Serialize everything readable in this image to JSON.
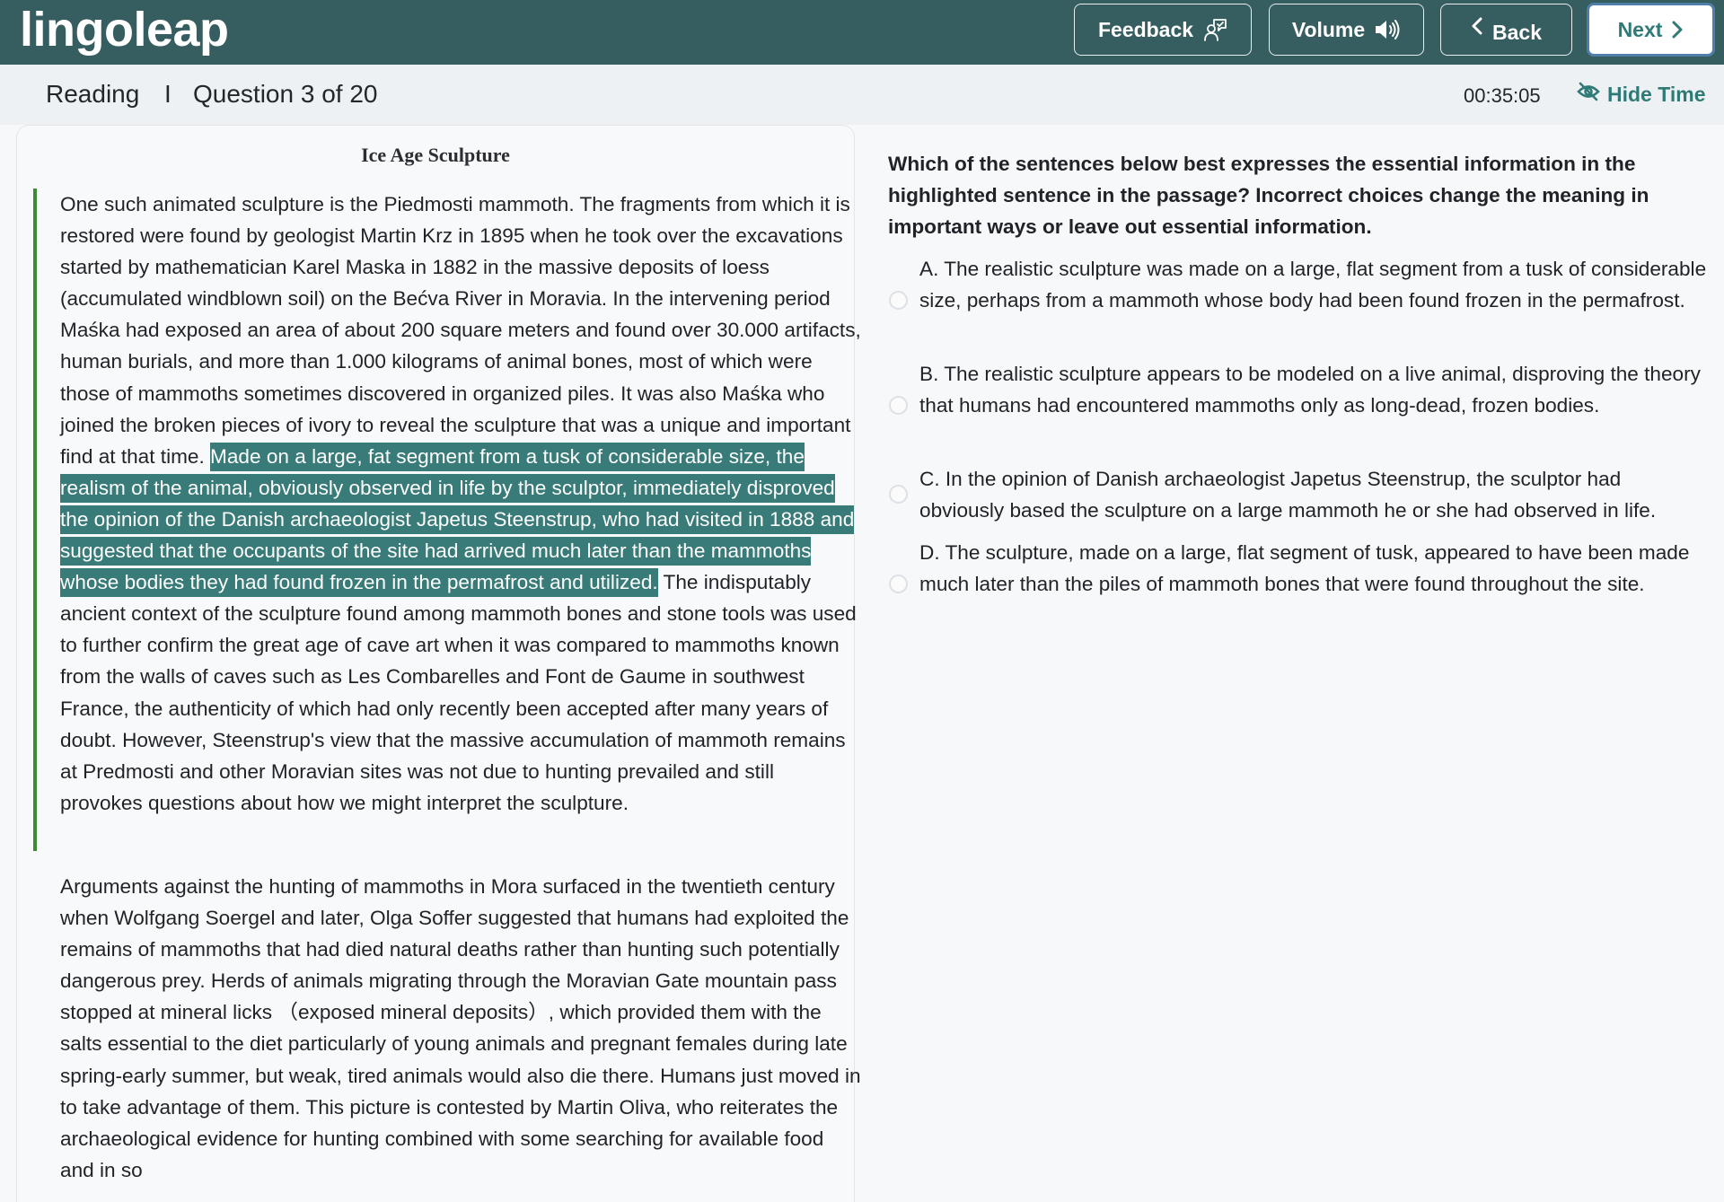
{
  "header": {
    "logo": "lingoleap",
    "buttons": {
      "feedback": "Feedback",
      "volume": "Volume",
      "back": "Back",
      "next": "Next"
    },
    "icons": {
      "feedback": "feedback-person-chat-icon",
      "volume": "speaker-volume-icon",
      "back": "chevron-left-icon",
      "next": "chevron-right-icon"
    }
  },
  "subheader": {
    "section": "Reading",
    "separator": "I",
    "question_progress": "Question 3 of 20",
    "timer": "00:35:05",
    "hide_time_label": "Hide Time",
    "hide_time_icon": "eye-slash-icon"
  },
  "passage": {
    "title": "Ice Age Sculpture",
    "paragraph1": {
      "before_highlight": "One such animated sculpture is the Piedmosti mammoth. The fragments from which it is restored were found by geologist Martin Krz in 1895 when he took over the excavations started by mathematician Karel Maska in 1882 in the massive deposits of loess (accumulated windblown soil) on the Bećva River in Moravia. In the intervening period Maśka had exposed an area of about 200 square meters and found over 30.000 artifacts, human burials, and more than 1.000 kilograms of animal bones, most of which were those of mammoths sometimes discovered in organized piles. It was also Maśka who joined the broken pieces of ivory to reveal the sculpture that was a unique and important find at that time. ",
      "highlight": "Made on a large, fat segment from a tusk of considerable size, the realism of the animal, obviously observed in life by the sculptor, immediately disproved the opinion of the Danish archaeologist Japetus Steenstrup, who had visited in 1888 and suggested that the occupants of the site had arrived much later than the mammoths whose bodies they had found frozen in the permafrost and utilized.",
      "after_highlight": " The indisputably ancient context of the sculpture found among mammoth bones and stone tools was used to further confirm the great age of cave art when it was compared to mammoths known from the walls of caves such as Les Combarelles and Font de Gaume in southwest France, the authenticity of which had only recently been accepted after many years of doubt. However, Steenstrup's view that the massive accumulation of mammoth remains at Predmosti and other Moravian sites was not due to hunting prevailed and still provokes questions about how we might interpret the sculpture."
    },
    "paragraph2": "Arguments against the hunting of mammoths in Mora surfaced in the twentieth century when Wolfgang Soergel and later, Olga Soffer suggested that humans had exploited the remains of mammoths that had died natural deaths rather than hunting such potentially dangerous prey. Herds of animals migrating through the Moravian Gate mountain pass stopped at mineral licks （exposed mineral deposits）, which provided them with the salts essential to the diet particularly of young animals and pregnant females during late spring-early summer, but weak, tired animals would also die there. Humans just moved in to take advantage of them. This picture is contested by Martin Oliva, who reiterates the archaeological evidence for hunting combined with some searching for available food and in so"
  },
  "question": {
    "prompt": "Which of the sentences below best expresses the essential information in the highlighted sentence in the passage? Incorrect choices change the meaning in important ways or leave out essential information.",
    "options": [
      {
        "label": "A. The realistic sculpture was made on a large, flat segment from a tusk of considerable size, perhaps from a mammoth whose body had been found frozen in the permafrost.",
        "selected": false
      },
      {
        "label": "B. The realistic sculpture appears to be modeled on a live animal, disproving the theory that humans had encountered mammoths only as long-dead, frozen bodies.",
        "selected": false
      },
      {
        "label": "C. In the opinion of Danish archaeologist Japetus Steenstrup, the sculptor had obviously based the sculpture on a large mammoth he or she had observed in life.",
        "selected": false
      },
      {
        "label": "D. The sculpture, made on a large, flat segment of tusk, appeared to have been made much later than the piles of mammoth bones that were found throughout the site.",
        "selected": false
      }
    ]
  },
  "colors": {
    "header_bg": "#365d5f",
    "accent": "#2f7a76",
    "highlight_bg": "#387b78",
    "paragraph_marker": "#3e8a32",
    "focus_ring": "#4f7fa8"
  }
}
